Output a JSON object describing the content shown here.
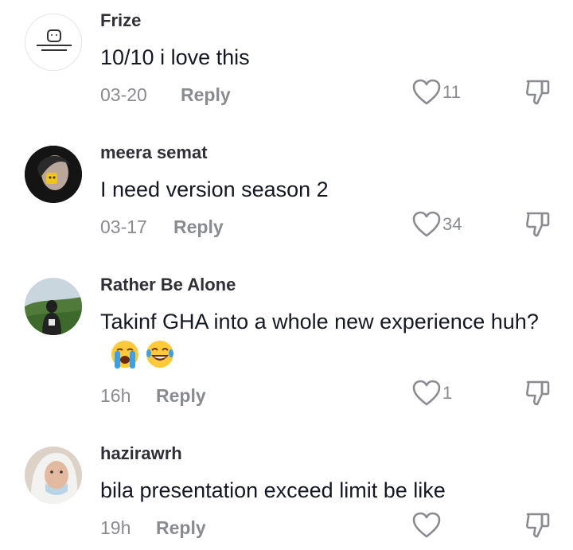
{
  "comments": [
    {
      "username": "Frize",
      "text": "10/10 i love this",
      "date": "03-20",
      "reply": "Reply",
      "likes": "11",
      "avatar_icon": "toast-avatar-icon",
      "emojis": []
    },
    {
      "username": "meera semat",
      "text": "I need version season 2",
      "date": "03-17",
      "reply": "Reply",
      "likes": "34",
      "avatar_icon": "girl-avatar-icon",
      "emojis": []
    },
    {
      "username": "Rather Be Alone",
      "text": "Takinf GHA into a whole new experience huh?",
      "date": "16h",
      "reply": "Reply",
      "likes": "1",
      "avatar_icon": "landscape-avatar-icon",
      "emojis": [
        "loudly-crying-face",
        "face-with-tears-of-joy"
      ]
    },
    {
      "username": "hazirawrh",
      "text": "bila presentation exceed limit be like",
      "date": "19h",
      "reply": "Reply",
      "likes": "",
      "avatar_icon": "masked-girl-avatar-icon",
      "emojis": []
    }
  ],
  "icons": {
    "like": "heart-outline-icon",
    "dislike": "thumbs-down-icon"
  },
  "colors": {
    "text": "#161823",
    "secondary": "#8a8b91",
    "username": "#2f2f35"
  }
}
